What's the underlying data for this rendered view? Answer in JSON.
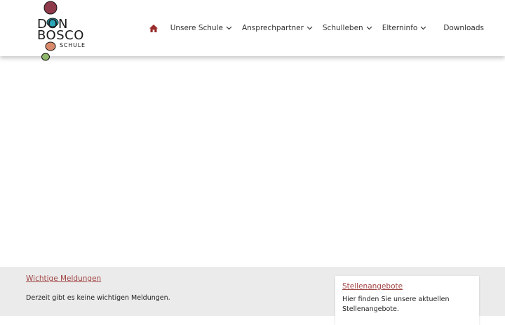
{
  "logo": {
    "line1": "DON",
    "line2": "BOSCO",
    "line3": "SCHULE",
    "colors": {
      "top": "#8e3a4a",
      "teal": "#2aa6b8",
      "peach": "#d98a6a",
      "green": "#8fb86a",
      "text": "#1a1a1a"
    }
  },
  "nav": {
    "home_icon": "home-icon",
    "items": [
      {
        "label": "Unsere Schule"
      },
      {
        "label": "Ansprechpartner"
      },
      {
        "label": "Schulleben"
      },
      {
        "label": "Elterninfo"
      },
      {
        "label": "Downloads"
      }
    ],
    "accent": "#9b2b2b"
  },
  "notices": {
    "title": "Wichtige Meldungen",
    "text": "Derzeit gibt es keine wichtigen Meldungen."
  },
  "jobs": {
    "title": "Stellenangebote",
    "text": "Hier finden Sie unsere aktuellen Stellenangebote."
  },
  "colors": {
    "link": "#a24545",
    "footer_bg": "#ebebeb"
  }
}
